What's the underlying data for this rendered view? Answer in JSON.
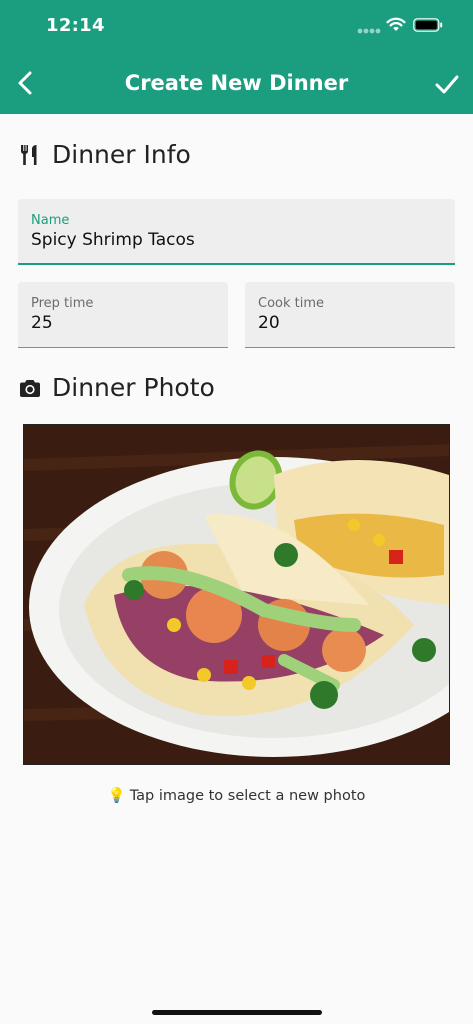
{
  "status_bar": {
    "time": "12:14"
  },
  "header": {
    "title": "Create New Dinner",
    "back_icon": "chevron-left-icon",
    "done_icon": "checkmark-icon"
  },
  "info_section": {
    "title": "Dinner Info",
    "icon": "utensils-icon"
  },
  "fields": {
    "name": {
      "label": "Name",
      "value": "Spicy Shrimp Tacos"
    },
    "prep_time": {
      "label": "Prep time",
      "value": "25"
    },
    "cook_time": {
      "label": "Cook time",
      "value": "20"
    }
  },
  "photo_section": {
    "title": "Dinner Photo",
    "icon": "camera-icon"
  },
  "hint": {
    "icon": "💡",
    "text": "Tap image to select a new photo"
  },
  "colors": {
    "primary": "#1a9e7f",
    "background": "#fafafa",
    "field_bg": "#eeeeee"
  }
}
